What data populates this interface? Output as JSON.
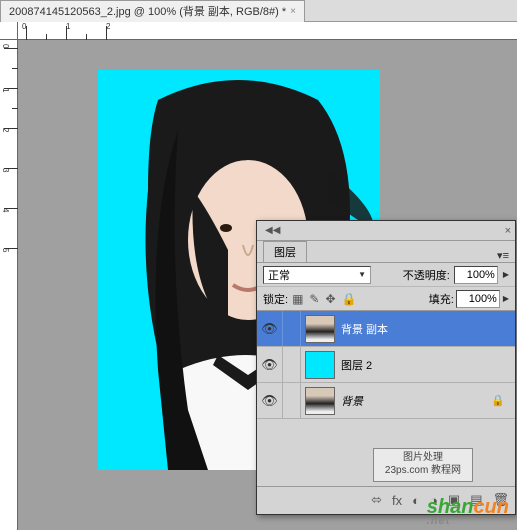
{
  "tab": {
    "title": "200874145120563_2.jpg @ 100% (背景 副本, RGB/8#) *"
  },
  "layers_panel": {
    "title": "图层",
    "blend_mode": "正常",
    "opacity_label": "不透明度:",
    "opacity_value": "100%",
    "lock_label": "锁定:",
    "fill_label": "填充:",
    "fill_value": "100%",
    "layers": [
      {
        "name": "背景 副本",
        "selected": true,
        "thumb": "portrait"
      },
      {
        "name": "图层 2",
        "selected": false,
        "thumb": "cyan"
      },
      {
        "name": "背景",
        "selected": false,
        "thumb": "portrait",
        "locked": true,
        "italic": true
      }
    ]
  },
  "watermark_box": {
    "line1": "图片处理",
    "line2": "23ps.com 教程网"
  },
  "watermark": {
    "text1": "shan",
    "text2": "cun",
    "sub": ".net"
  },
  "canvas": {
    "bg_color": "#00e8ff"
  }
}
